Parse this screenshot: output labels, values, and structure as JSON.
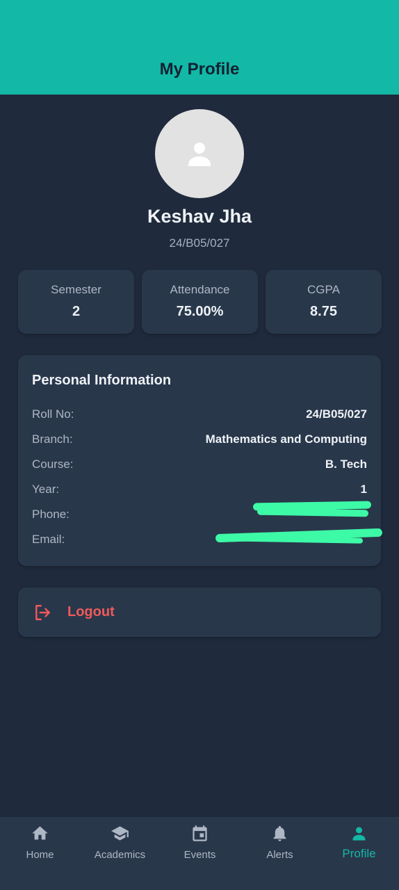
{
  "header": {
    "title": "My Profile"
  },
  "profile": {
    "name": "Keshav Jha",
    "roll_no": "24/B05/027",
    "avatar_icon": "person-icon"
  },
  "stats": [
    {
      "label": "Semester",
      "value": "2"
    },
    {
      "label": "Attendance",
      "value": "75.00%"
    },
    {
      "label": "CGPA",
      "value": "8.75"
    }
  ],
  "personal_info": {
    "title": "Personal Information",
    "rows": [
      {
        "label": "Roll No:",
        "value": "24/B05/027"
      },
      {
        "label": "Branch:",
        "value": "Mathematics and Computing"
      },
      {
        "label": "Course:",
        "value": "B. Tech"
      },
      {
        "label": "Year:",
        "value": "1"
      },
      {
        "label": "Phone:",
        "value": ""
      },
      {
        "label": "Email:",
        "value": ""
      }
    ]
  },
  "logout": {
    "label": "Logout",
    "icon": "logout-icon"
  },
  "bottom_nav": {
    "items": [
      {
        "label": "Home",
        "icon": "home-icon",
        "active": false
      },
      {
        "label": "Academics",
        "icon": "graduation-cap-icon",
        "active": false
      },
      {
        "label": "Events",
        "icon": "calendar-icon",
        "active": false
      },
      {
        "label": "Alerts",
        "icon": "bell-icon",
        "active": false
      },
      {
        "label": "Profile",
        "icon": "person-icon",
        "active": true
      }
    ]
  },
  "colors": {
    "accent": "#14b8a6",
    "background": "#1f2a3c",
    "card": "#29374b",
    "logout": "#f05a5a",
    "redaction": "#3dfaa6"
  }
}
